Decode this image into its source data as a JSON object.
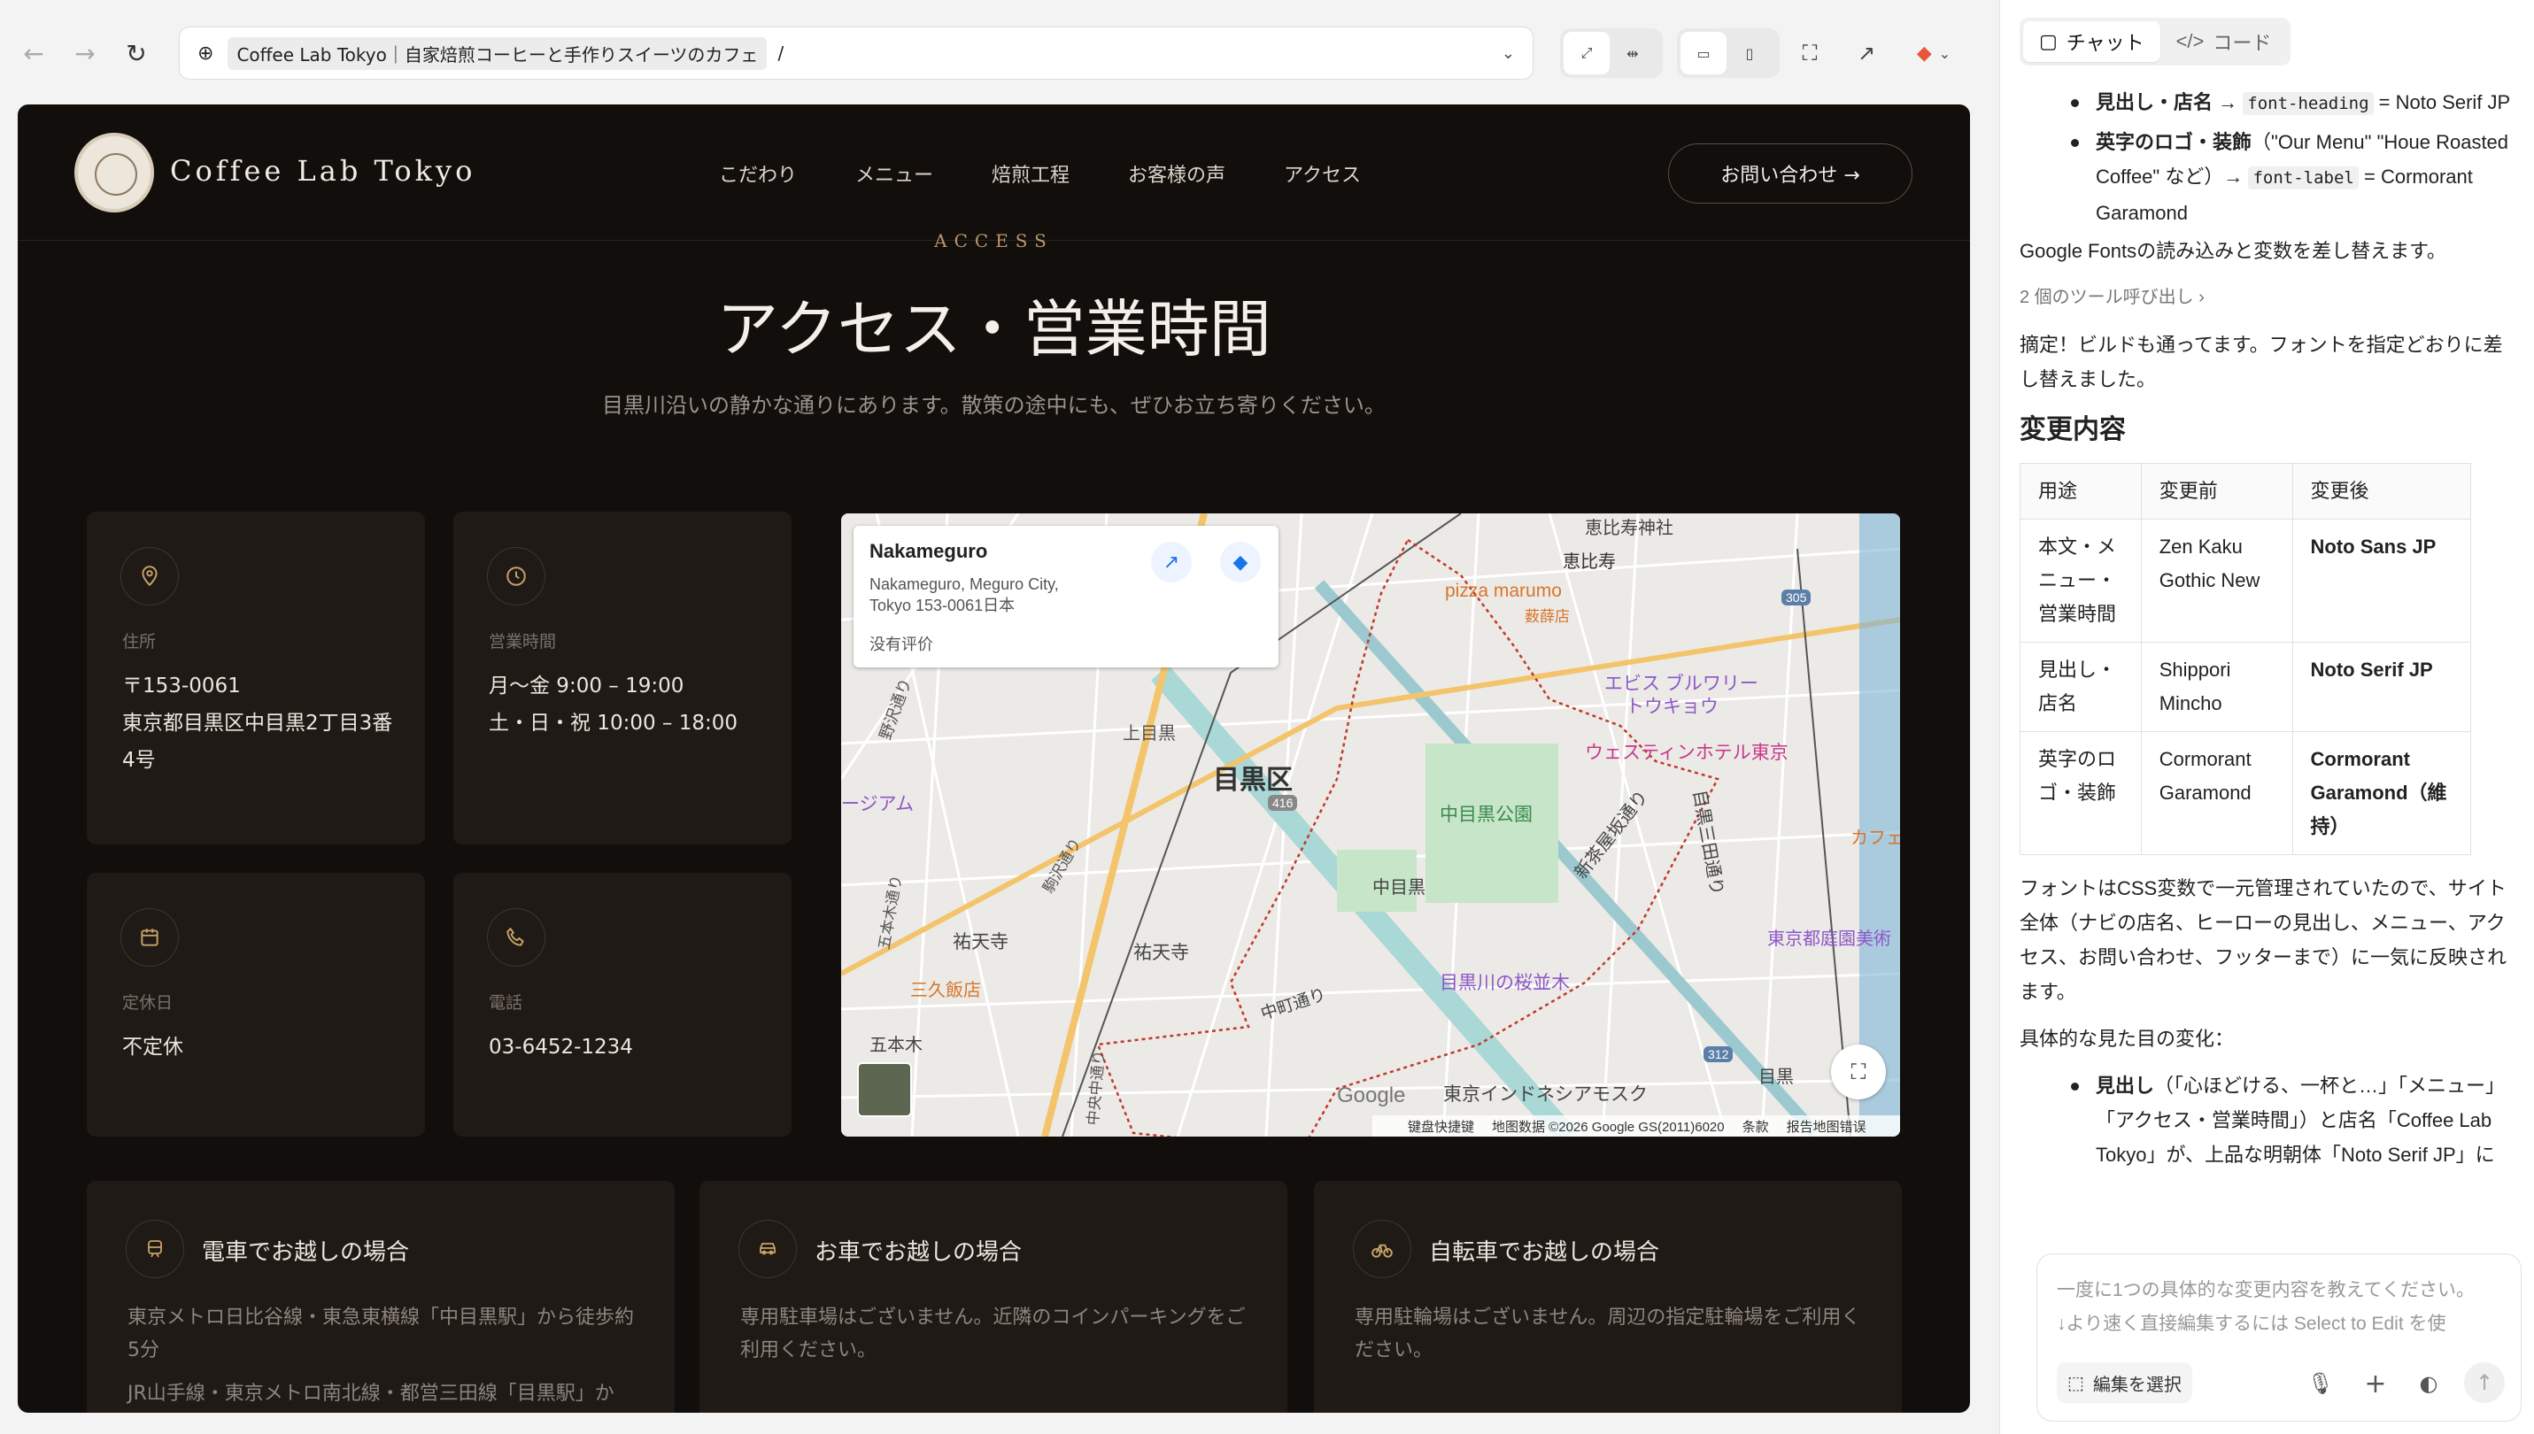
{
  "browser": {
    "site_chip": "Coffee Lab Tokyo｜自家焙煎コーヒーと手作りスイーツのカフェ",
    "path": "/"
  },
  "site": {
    "brand": "Coffee Lab Tokyo",
    "nav": [
      "こだわり",
      "メニュー",
      "焙煎工程",
      "お客様の声",
      "アクセス"
    ],
    "cta": "お問い合わせ →",
    "kicker": "ACCESS",
    "title": "アクセス・営業時間",
    "subtitle": "目黒川沿いの静かな通りにあります。散策の途中にも、ぜひお立ち寄りください。",
    "cards": [
      {
        "label": "住所",
        "lines": [
          "〒153-0061",
          "東京都目黒区中目黒2丁目3番",
          "4号"
        ]
      },
      {
        "label": "営業時間",
        "lines": [
          "月〜金 9:00 – 19:00",
          "土・日・祝 10:00 – 18:00"
        ]
      },
      {
        "label": "定休日",
        "lines": [
          "不定休"
        ]
      },
      {
        "label": "電話",
        "lines": [
          "03-6452-1234"
        ]
      }
    ],
    "map": {
      "popup_title": "Nakameguro",
      "popup_addr1": "Nakameguro, Meguro City,",
      "popup_addr2": "Tokyo 153-0061日本",
      "popup_rating": "没有评价",
      "labels": [
        "恵比寿神社",
        "恵比寿",
        "pizza marumo",
        "薮薛店",
        "エビス ブルワリー",
        "トウキョウ",
        "ウェスティンホテル東京",
        "上目黒",
        "目黒区",
        "中目黒公園",
        "中目黒",
        "新茶屋坂通り",
        "目黒三田通り",
        "カフェ",
        "東京都庭園美術",
        "野沢通り",
        "ージアム",
        "祐天寺",
        "祐天寺",
        "三久飯店",
        "五本木",
        "中町通り",
        "目黒川の桜並木",
        "東京インドネシアモスク",
        "目黒",
        "五本木通り",
        "駒沢通り",
        "中央中通り",
        "416",
        "305",
        "312"
      ],
      "footer": [
        "键盘快捷键",
        "地图数据 ©2026 Google GS(2011)6020",
        "条款",
        "报告地图错误"
      ],
      "google": "Google"
    },
    "transport": [
      {
        "title": "電車でお越しの場合",
        "lines": [
          "東京メトロ日比谷線・東急東横線「中目黒駅」から徒歩約5分",
          "JR山手線・東京メトロ南北線・都営三田線「目黒駅」か"
        ]
      },
      {
        "title": "お車でお越しの場合",
        "lines": [
          "専用駐車場はございません。近隣のコインパーキングをご利用ください。"
        ]
      },
      {
        "title": "自転車でお越しの場合",
        "lines": [
          "専用駐輪場はございません。周辺の指定駐輪場をご利用ください。"
        ]
      }
    ]
  },
  "panel": {
    "tabs": [
      "チャット",
      "コード"
    ],
    "b1_strong": "見出し・店名 →",
    "b1_code": "font-heading",
    "b1_rest": "= Noto Serif JP",
    "b2_strong": "英字のロゴ・装飾",
    "b2_mid": "（\"Our Menu\" \"Houe Roasted Coffee\" など）→",
    "b2_code": "font-label",
    "b2_rest": "= Cormorant Garamond",
    "p1": "Google Fontsの読み込みと変数を差し替えます。",
    "tools": "2 個のツール呼び出し ›",
    "p2": "摘定！ビルドも通ってます。フォントを指定どおりに差し替えました。",
    "h2": "変更内容",
    "table": {
      "head": [
        "用途",
        "変更前",
        "変更後"
      ],
      "rows": [
        [
          "本文・メニュー・営業時間",
          "Zen Kaku Gothic New",
          "Noto Sans JP"
        ],
        [
          "見出し・店名",
          "Shippori Mincho",
          "Noto Serif JP"
        ],
        [
          "英字のロゴ・装飾",
          "Cormorant Garamond",
          "Cormorant Garamond（維持）"
        ]
      ]
    },
    "p3": "フォントはCSS変数で一元管理されていたので、サイト全体（ナビの店名、ヒーローの見出し、メニュー、アクセス、お問い合わせ、フッターまで）に一気に反映されます。",
    "p4": "具体的な見た目の変化：",
    "b3_strong": "見出し",
    "b3_rest": "（「心ほどける、一杯と…」「メニュー」「アクセス・営業時間」）と店名「Coffee Lab Tokyo」が、上品な明朝体「Noto Serif JP」に",
    "composer_ph1": "一度に1つの具体的な変更内容を教えてください。",
    "composer_ph2": "↓より速く直接編集するには Select to Edit を使",
    "select_edit": "編集を選択"
  }
}
